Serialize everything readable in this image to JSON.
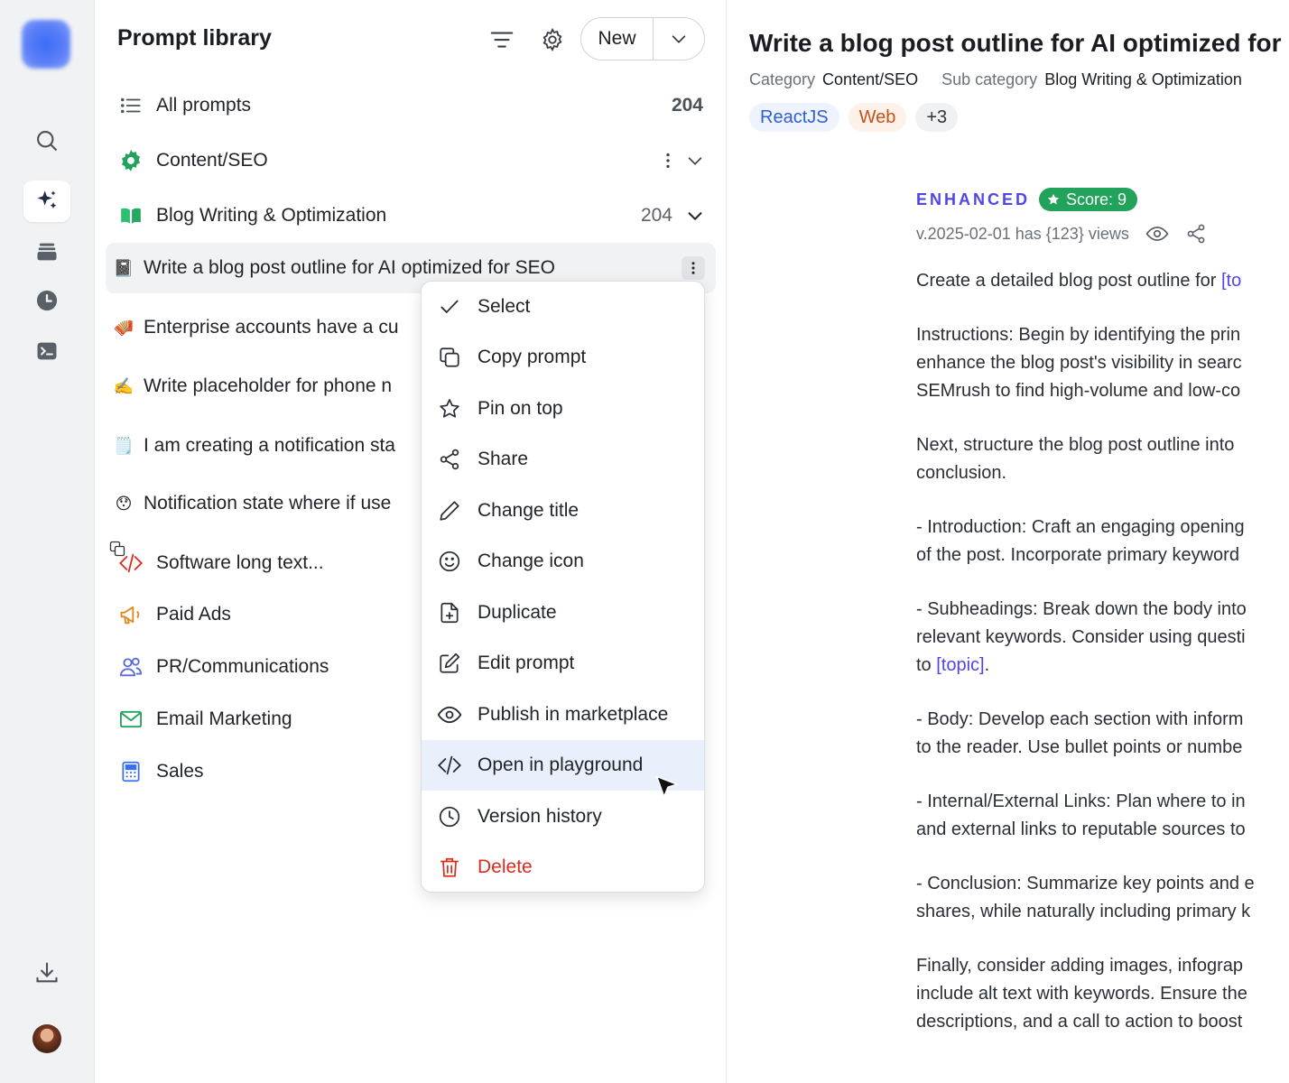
{
  "sidebar": {
    "nav": [
      "search-icon",
      "sparkles-icon",
      "stack-icon",
      "clock-icon",
      "terminal-icon"
    ],
    "bottom": [
      "download-icon",
      "avatar"
    ]
  },
  "library": {
    "title": "Prompt library",
    "new_label": "New",
    "all_prompts": {
      "label": "All prompts",
      "count": "204"
    },
    "category": {
      "label": "Content/SEO"
    },
    "subcategory": {
      "label": "Blog Writing & Optimization",
      "count": "204"
    },
    "prompts": [
      {
        "emoji": "📓",
        "label": "Write a blog post outline for AI optimized for SEO"
      },
      {
        "emoji": "🪗",
        "label": "Enterprise accounts have a cu"
      },
      {
        "emoji": "✍️",
        "label": "Write placeholder for phone n"
      },
      {
        "emoji": "🗒️",
        "label": "I am creating a notification sta"
      },
      {
        "emoji": "😯",
        "label": "Notification state where if use"
      }
    ],
    "categories": [
      {
        "label": "Software long text...",
        "icon": "code-icon",
        "color": "#d92d20"
      },
      {
        "label": "Paid Ads",
        "icon": "megaphone-icon",
        "color": "#e08a1e"
      },
      {
        "label": "PR/Communications",
        "icon": "users-icon",
        "color": "#5b6bd8"
      },
      {
        "label": "Email Marketing",
        "icon": "mail-icon",
        "color": "#22a35b"
      },
      {
        "label": "Sales",
        "icon": "calculator-icon",
        "color": "#3b6cf6"
      }
    ]
  },
  "menu": {
    "items": [
      {
        "label": "Select",
        "icon": "check-icon"
      },
      {
        "label": "Copy prompt",
        "icon": "copy-icon"
      },
      {
        "label": "Pin on top",
        "icon": "star-icon"
      },
      {
        "label": "Share",
        "icon": "share-icon"
      },
      {
        "label": "Change title",
        "icon": "pencil-icon"
      },
      {
        "label": "Change icon",
        "icon": "smile-icon"
      },
      {
        "label": "Duplicate",
        "icon": "file-plus-icon"
      },
      {
        "label": "Edit prompt",
        "icon": "edit-icon"
      },
      {
        "label": "Publish in marketplace",
        "icon": "eye-icon"
      },
      {
        "label": "Open in playground",
        "icon": "code-icon"
      },
      {
        "label": "Version history",
        "icon": "clock-icon"
      },
      {
        "label": "Delete",
        "icon": "trash-icon"
      }
    ],
    "hovered": "Open in playground"
  },
  "detail": {
    "title": "Write a blog post outline for AI optimized for S",
    "category_key": "Category",
    "category_value": "Content/SEO",
    "subcategory_key": "Sub category",
    "subcategory_value": "Blog Writing & Optimization",
    "tags": [
      "ReactJS",
      "Web",
      "+3"
    ],
    "enhanced_label": "ENHANCED",
    "score_label": "Score: 9",
    "version_text": "v.2025-02-01 has {123} views",
    "paragraphs": [
      [
        "Create a detailed blog post outline for ",
        "[to"
      ],
      [
        "Instructions: Begin by identifying the prin",
        "enhance the blog post's visibility in searc",
        "SEMrush to find high-volume and low-co"
      ],
      [
        "Next, structure the blog post outline into",
        "conclusion."
      ],
      [
        "- Introduction: Craft an engaging opening",
        "of the post. Incorporate primary keyword"
      ],
      [
        "- Subheadings: Break down the body into",
        "relevant keywords. Consider using questi",
        "to ",
        "[topic]",
        "."
      ],
      [
        "- Body: Develop each section with inform",
        "to the reader. Use bullet points or numbe"
      ],
      [
        "- Internal/External Links: Plan where to in",
        "and external links to reputable sources to"
      ],
      [
        "- Conclusion: Summarize key points and e",
        "shares, while naturally including primary k"
      ],
      [
        "Finally, consider adding images, infograp",
        "include alt text with keywords. Ensure the",
        "descriptions, and a call to action to boost"
      ]
    ]
  },
  "colors": {
    "accent": "#4f46e5",
    "danger": "#d92d20",
    "score": "#22a35b"
  }
}
